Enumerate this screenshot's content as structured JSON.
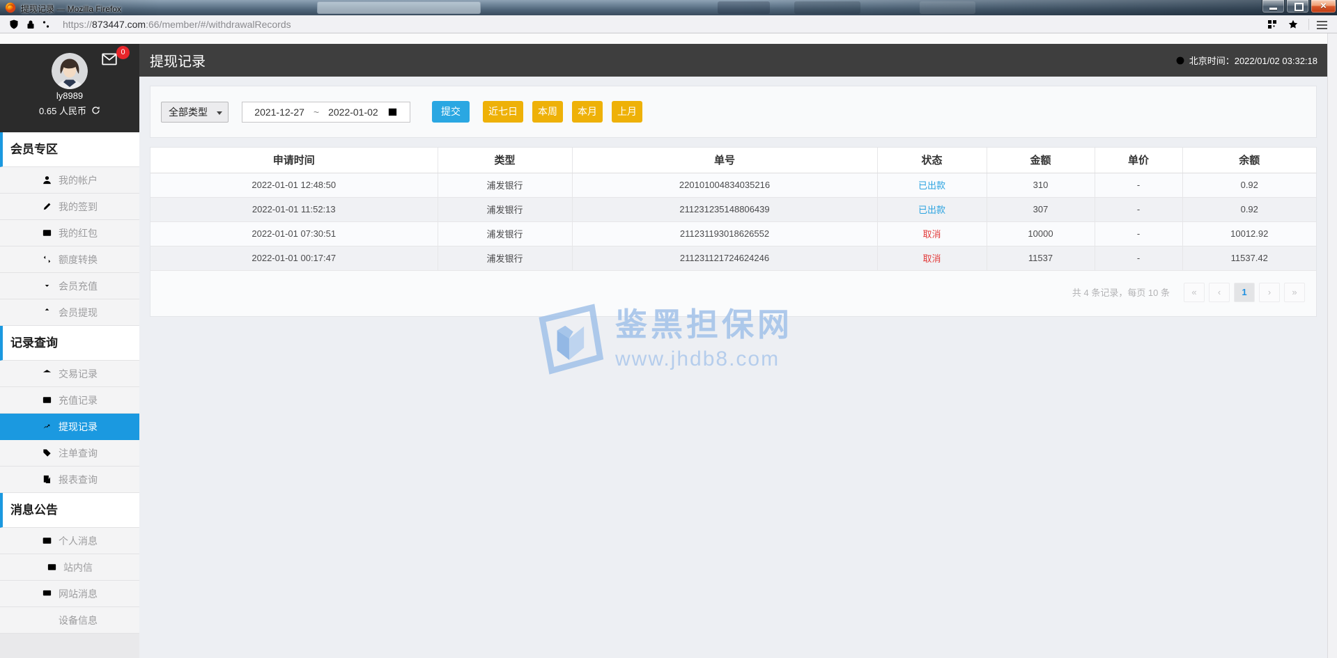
{
  "browser": {
    "window_title": "提现记录 — Mozilla Firefox",
    "url_scheme": "https://",
    "url_host": "873447.com",
    "url_path": ":66/member/#/withdrawalRecords"
  },
  "user_panel": {
    "username": "ly8989",
    "balance": "0.65 人民币",
    "badge_count": "0"
  },
  "topbar": {
    "page_title": "提现记录",
    "beijing_time": "北京时间：2022/01/02 03:32:18"
  },
  "sidebar": {
    "sections": [
      {
        "title": "会员专区",
        "items": [
          "我的帐户",
          "我的签到",
          "我的红包",
          "额度转换",
          "会员充值",
          "会员提现"
        ]
      },
      {
        "title": "记录查询",
        "items": [
          "交易记录",
          "充值记录",
          "提现记录",
          "注单查询",
          "报表查询"
        ]
      },
      {
        "title": "消息公告",
        "items": [
          "个人消息",
          "站内信",
          "网站消息",
          "设备信息"
        ]
      }
    ]
  },
  "filters": {
    "type_select": "全部类型",
    "date_from": "2021-12-27",
    "date_separator": "~",
    "date_to": "2022-01-02",
    "submit": "提交",
    "quick_ranges": [
      "近七日",
      "本周",
      "本月",
      "上月"
    ]
  },
  "table": {
    "headers": [
      "申请时间",
      "类型",
      "单号",
      "状态",
      "金额",
      "单价",
      "余额"
    ],
    "rows": [
      [
        "2022-01-01 12:48:50",
        "浦发银行",
        "220101004834035216",
        "已出款",
        "310",
        "-",
        "0.92"
      ],
      [
        "2022-01-01 11:52:13",
        "浦发银行",
        "211231235148806439",
        "已出款",
        "307",
        "-",
        "0.92"
      ],
      [
        "2022-01-01 07:30:51",
        "浦发银行",
        "211231193018626552",
        "取消",
        "10000",
        "-",
        "10012.92"
      ],
      [
        "2022-01-01 00:17:47",
        "浦发银行",
        "211231121724624246",
        "取消",
        "11537",
        "-",
        "11537.42"
      ]
    ]
  },
  "pagination": {
    "summary": "共 4 条记录，每页 10 条",
    "first": "«",
    "prev": "‹",
    "page": "1",
    "next": "›",
    "last": "»"
  },
  "watermark": {
    "title": "鉴黑担保网",
    "url": "www.jhdb8.com"
  },
  "colors": {
    "accent": "#1b99e0",
    "status_paid": "#2ba3e0",
    "status_cancel": "#e23c3c",
    "quick_button": "#eeb108",
    "submit_button": "#2aa7e2",
    "badge": "#e8252a"
  }
}
